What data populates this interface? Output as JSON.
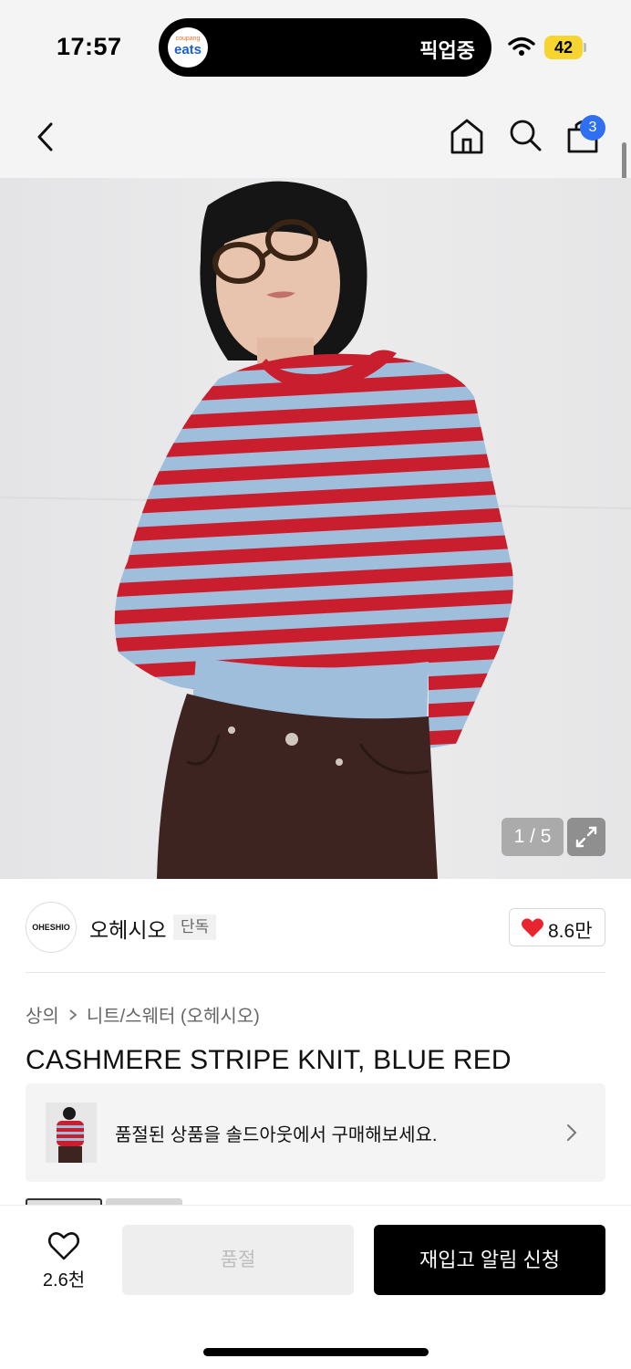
{
  "status_bar": {
    "time": "17:57",
    "app_badge_small": "coupang",
    "app_badge_big": "eats",
    "live_activity": "픽업중",
    "battery": "42"
  },
  "header": {
    "cart_count": "3"
  },
  "gallery": {
    "counter": "1 / 5"
  },
  "brand": {
    "logo_text": "OHESHIO",
    "name": "오헤시오",
    "tag": "단독",
    "likes": "8.6만"
  },
  "breadcrumb": [
    "상의",
    "니트/스웨터 (오헤시오)"
  ],
  "product": {
    "title": "CASHMERE STRIPE KNIT, BLUE RED"
  },
  "banner": {
    "text": "품절된 상품을 솔드아웃에서 구매해보세요."
  },
  "bottom_bar": {
    "wish_count": "2.6천",
    "soldout_label": "품절",
    "restock_label": "재입고 알림 신청"
  },
  "colors": {
    "accent_blue": "#2f6ff2",
    "heart_red": "#e8242f",
    "stripe_red": "#c81e2e",
    "stripe_blue": "#9fbedc",
    "pants_brown": "#3d2420"
  }
}
